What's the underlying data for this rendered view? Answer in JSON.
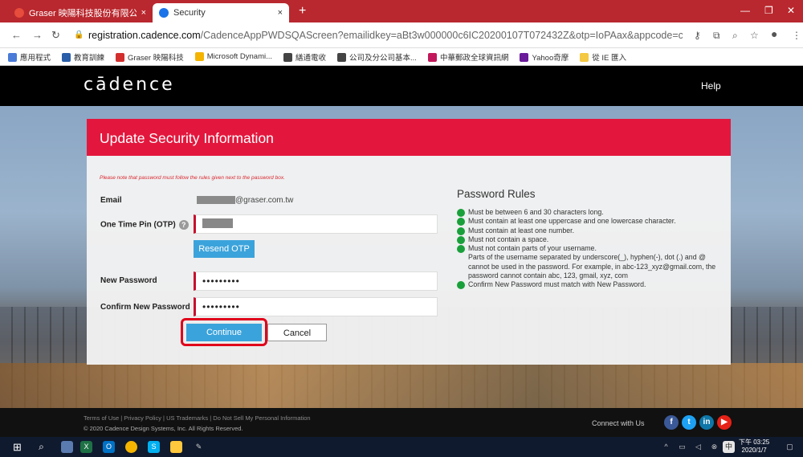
{
  "browser": {
    "tabs": [
      {
        "title": "Graser 映陽科技股份有限公司",
        "close": "×"
      },
      {
        "title": "Security",
        "close": "×"
      }
    ],
    "new_tab": "+",
    "url_host": "registration.cadence.com",
    "url_path": "/CadenceAppPWDSQAScreen?emailidkey=aBt3w000000c6IC20200107T072432Z&otp=IoPAax&appcode=cos&langcode=en",
    "bookmarks": [
      {
        "label": "應用程式",
        "color": "#4a7bd8"
      },
      {
        "label": "教育訓練",
        "color": "#2a5ea8"
      },
      {
        "label": "Graser 映陽科技",
        "color": "#d32f2f"
      },
      {
        "label": "Microsoft Dynami...",
        "color": "#f4b400"
      },
      {
        "label": "繕通電收",
        "color": "#444444"
      },
      {
        "label": "公司及分公司基本...",
        "color": "#444444"
      },
      {
        "label": "中華郵政全球資訊網",
        "color": "#c2185b"
      },
      {
        "label": "Yahoo奇摩",
        "color": "#6a1b9a"
      },
      {
        "label": "從 IE 匯入",
        "color": "#f4c842"
      }
    ]
  },
  "header": {
    "logo": "cādence",
    "help": "Help"
  },
  "form": {
    "title": "Update Security Information",
    "note": "Please note that password must follow the rules given next to the password box.",
    "email_label": "Email",
    "email_value": "@graser.com.tw",
    "otp_label": "One Time Pin (OTP)",
    "resend_label": "Resend OTP",
    "new_password_label": "New Password",
    "new_password_value": "•••••••••",
    "confirm_password_label": "Confirm New Password",
    "confirm_password_value": "•••••••••",
    "continue_label": "Continue",
    "cancel_label": "Cancel"
  },
  "rules": {
    "title": "Password Rules",
    "items": [
      "Must be between 6 and 30 characters long.",
      "Must contain at least one uppercase and one lowercase character.",
      "Must contain at least one number.",
      "Must not contain a space.",
      "Must not contain parts of your username.",
      "Confirm New Password must match with New Password."
    ],
    "username_detail": "Parts of the username separated by underscore(_), hyphen(-), dot (.) and @ cannot be used in the password. For example, in abc-123_xyz@gmail.com, the password cannot contain abc, 123, gmail, xyz, com"
  },
  "footer": {
    "links": "Terms of Use | Privacy Policy | US Trademarks | Do Not Sell My Personal Information",
    "copyright": "© 2020 Cadence Design Systems, Inc. All Rights Reserved.",
    "connect": "Connect with Us"
  },
  "taskbar": {
    "time": "下午 03:25",
    "date": "2020/1/7"
  },
  "colors": {
    "brand_red": "#e3173d",
    "button_blue": "#3ba3db",
    "rule_green": "#19a03a"
  }
}
